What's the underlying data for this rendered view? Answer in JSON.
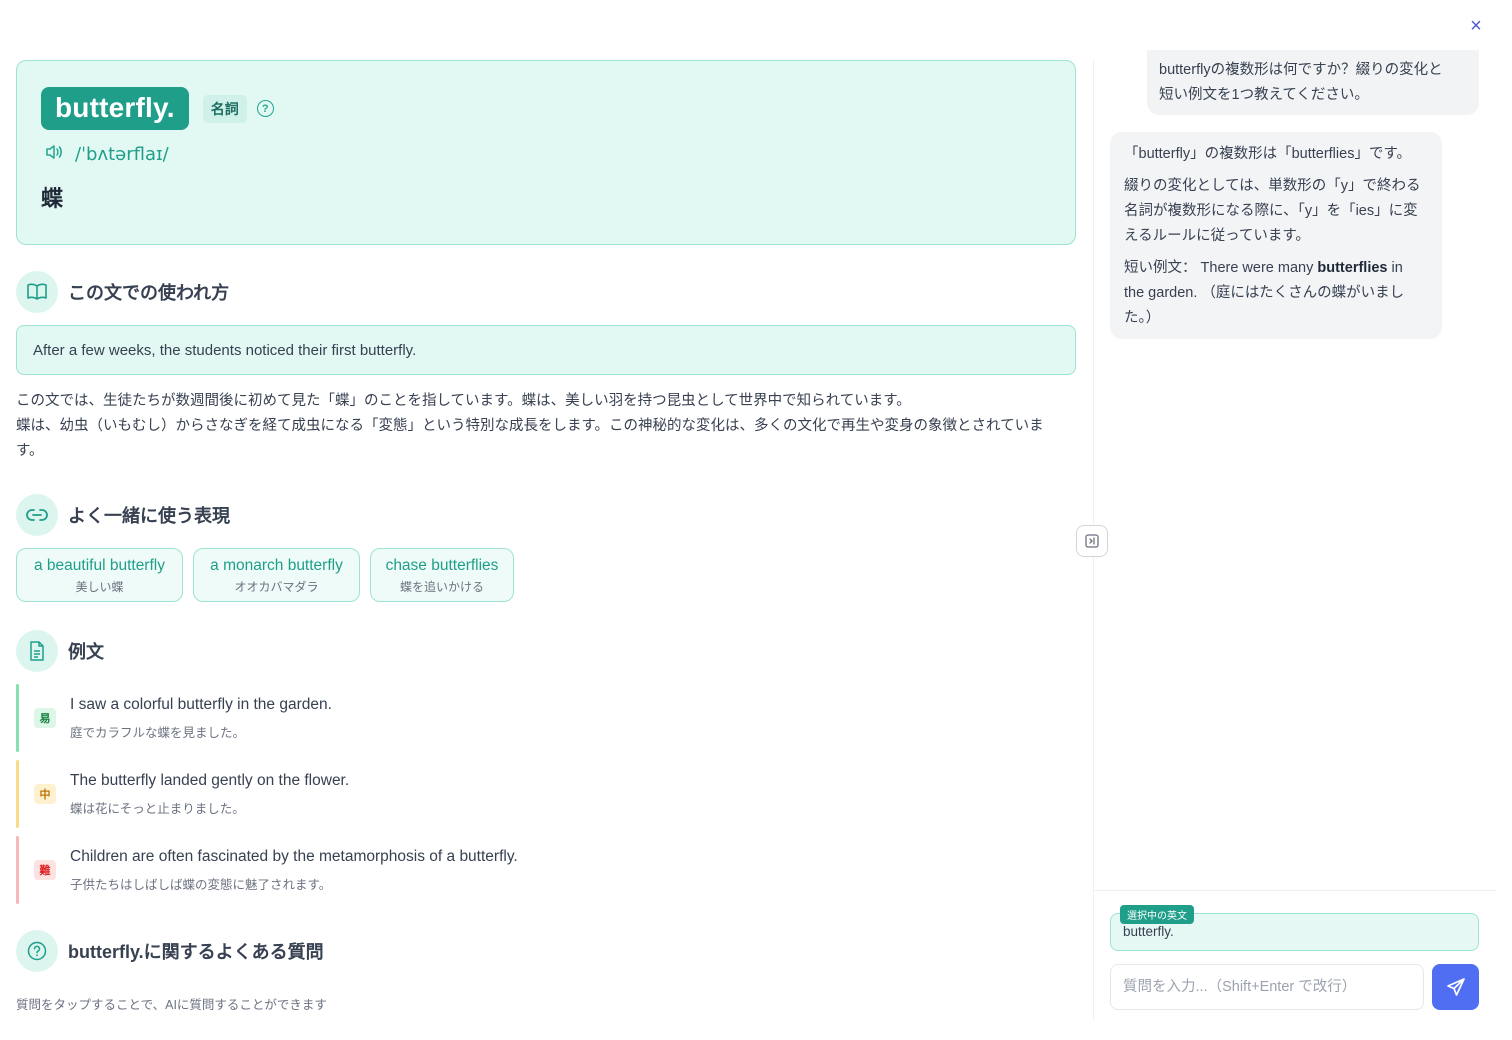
{
  "close_icon": "×",
  "word": {
    "text": "butterfly.",
    "pos": "名詞",
    "pronunciation": "/ˈbʌtərflaɪ/",
    "meaning": "蝶"
  },
  "usage": {
    "title": "この文での使われ方",
    "sentence": "After a few weeks, the students noticed their first butterfly.",
    "description_line1": "この文では、生徒たちが数週間後に初めて見た「蝶」のことを指しています。蝶は、美しい羽を持つ昆虫として世界中で知られています。",
    "description_line2": "蝶は、幼虫（いもむし）からさなぎを経て成虫になる「変態」という特別な成長をします。この神秘的な変化は、多くの文化で再生や変身の象徴とされていま",
    "description_line3": "す。"
  },
  "collocations": {
    "title": "よく一緒に使う表現",
    "items": [
      {
        "en": "a beautiful butterfly",
        "ja": "美しい蝶"
      },
      {
        "en": "a monarch butterfly",
        "ja": "オオカバマダラ"
      },
      {
        "en": "chase butterflies",
        "ja": "蝶を追いかける"
      }
    ]
  },
  "examples": {
    "title": "例文",
    "items": [
      {
        "level": "易",
        "en": "I saw a colorful butterfly in the garden.",
        "ja": "庭でカラフルな蝶を見ました。",
        "color": "#86e0b0"
      },
      {
        "level": "中",
        "en": "The butterfly landed gently on the flower.",
        "ja": "蝶は花にそっと止まりました。",
        "color": "#f8dc8a"
      },
      {
        "level": "難",
        "en": "Children are often fascinated by the metamorphosis of a butterfly.",
        "ja": "子供たちはしばしば蝶の変態に魅了されます。",
        "color": "#f6b8b8"
      }
    ]
  },
  "faq": {
    "title": "butterfly.に関するよくある質問",
    "note": "質問をタップすることで、AIに質問することができます"
  },
  "chat": {
    "user_message_l1": "butterflyの複数形は何ですか？綴りの変化と",
    "user_message_l2": "短い例文を1つ教えてください。",
    "ai_p1": "「butterfly」の複数形は「butterflies」です。",
    "ai_p2_l1": "綴りの変化としては、単数形の「y」で終わる",
    "ai_p2_l2": "名詞が複数形になる際に、「y」を「ies」に変",
    "ai_p2_l3": "えるルールに従っています。",
    "ai_p3_prefix": "短い例文： There were many ",
    "ai_p3_bold": "butterflies",
    "ai_p3_suffix": " in",
    "ai_p3_l2": "the garden. （庭にはたくさんの蝶がいまし",
    "ai_p3_l3": "た。）",
    "selected_label": "選択中の英文",
    "selected_text": "butterfly.",
    "input_placeholder": "質問を入力...（Shift+Enter で改行）"
  }
}
